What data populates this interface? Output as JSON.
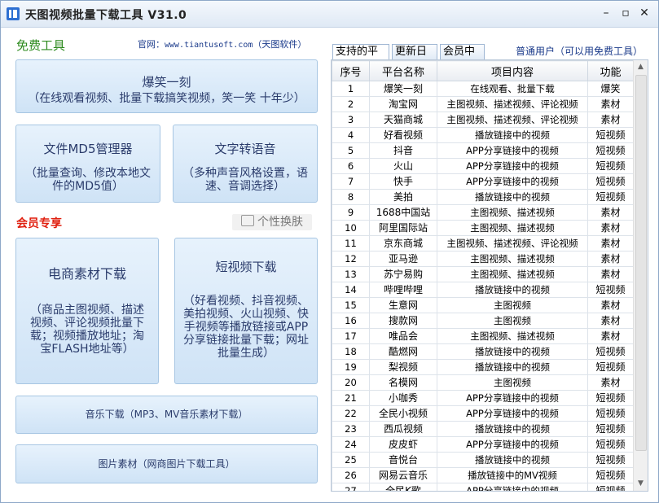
{
  "window": {
    "title": "天图视频批量下载工具 V31.0",
    "minimize": "–",
    "maximize": "▫",
    "close": "✕"
  },
  "left": {
    "free_title": "免费工具",
    "official_label": "官网：",
    "official_url": "www.tiantusoft.com",
    "official_suffix": "（天图软件）",
    "tiles": {
      "baoxiao": {
        "title": "爆笑一刻",
        "desc": "（在线观看视频、批量下载搞笑视频，笑一笑 十年少）"
      },
      "md5": {
        "title": "文件MD5管理器",
        "desc": "（批量查询、修改本地文件的MD5值）"
      },
      "tts": {
        "title": "文字转语音",
        "desc": "（多种声音风格设置，语速、音调选择）"
      },
      "ecommerce": {
        "title": "电商素材下载",
        "desc": "（商品主图视频、描述视频、评论视频批量下载；视频播放地址；淘宝FLASH地址等）"
      },
      "shortvideo": {
        "title": "短视频下载",
        "desc": "（好看视频、抖音视频、美拍视频、火山视频、快手视频等播放链接或APP分享链接批量下载；网址批量生成）"
      },
      "music": {
        "title": "音乐下载（MP3、MV音乐素材下载）"
      },
      "image": {
        "title": "图片素材（网商图片下载工具）"
      }
    },
    "member_title": "会员专享",
    "skin_label": "个性换肤"
  },
  "right": {
    "tabs": [
      "支持的平台",
      "更新日志",
      "会员中心"
    ],
    "user_status": "普通用户（可以用免费工具）",
    "columns": [
      "序号",
      "平台名称",
      "项目内容",
      "功能"
    ],
    "rows": [
      [
        "1",
        "爆笑一刻",
        "在线观看、批量下载",
        "爆笑"
      ],
      [
        "2",
        "淘宝网",
        "主图视频、描述视频、评论视频",
        "素材"
      ],
      [
        "3",
        "天猫商城",
        "主图视频、描述视频、评论视频",
        "素材"
      ],
      [
        "4",
        "好看视频",
        "播放链接中的视频",
        "短视频"
      ],
      [
        "5",
        "抖音",
        "APP分享链接中的视频",
        "短视频"
      ],
      [
        "6",
        "火山",
        "APP分享链接中的视频",
        "短视频"
      ],
      [
        "7",
        "快手",
        "APP分享链接中的视频",
        "短视频"
      ],
      [
        "8",
        "美拍",
        "播放链接中的视频",
        "短视频"
      ],
      [
        "9",
        "1688中国站",
        "主图视频、描述视频",
        "素材"
      ],
      [
        "10",
        "阿里国际站",
        "主图视频、描述视频",
        "素材"
      ],
      [
        "11",
        "京东商城",
        "主图视频、描述视频、评论视频",
        "素材"
      ],
      [
        "12",
        "亚马逊",
        "主图视频、描述视频",
        "素材"
      ],
      [
        "13",
        "苏宁易购",
        "主图视频、描述视频",
        "素材"
      ],
      [
        "14",
        "哔哩哔哩",
        "播放链接中的视频",
        "短视频"
      ],
      [
        "15",
        "生意网",
        "主图视频",
        "素材"
      ],
      [
        "16",
        "搜款网",
        "主图视频",
        "素材"
      ],
      [
        "17",
        "唯品会",
        "主图视频、描述视频",
        "素材"
      ],
      [
        "18",
        "酷燃网",
        "播放链接中的视频",
        "短视频"
      ],
      [
        "19",
        "梨视频",
        "播放链接中的视频",
        "短视频"
      ],
      [
        "20",
        "名模网",
        "主图视频",
        "素材"
      ],
      [
        "21",
        "小咖秀",
        "APP分享链接中的视频",
        "短视频"
      ],
      [
        "22",
        "全民小视频",
        "APP分享链接中的视频",
        "短视频"
      ],
      [
        "23",
        "西瓜视频",
        "播放链接中的视频",
        "短视频"
      ],
      [
        "24",
        "皮皮虾",
        "APP分享链接中的视频",
        "短视频"
      ],
      [
        "25",
        "音悦台",
        "播放链接中的视频",
        "短视频"
      ],
      [
        "26",
        "网易云音乐",
        "播放链接中的MV视频",
        "短视频"
      ],
      [
        "27",
        "全民K歌",
        "APP分享链接中的视频",
        "短视频"
      ]
    ]
  },
  "colors": {
    "free_green": "#2e8b1f",
    "member_red": "#e02010",
    "accent_blue": "#1a3a8a"
  }
}
